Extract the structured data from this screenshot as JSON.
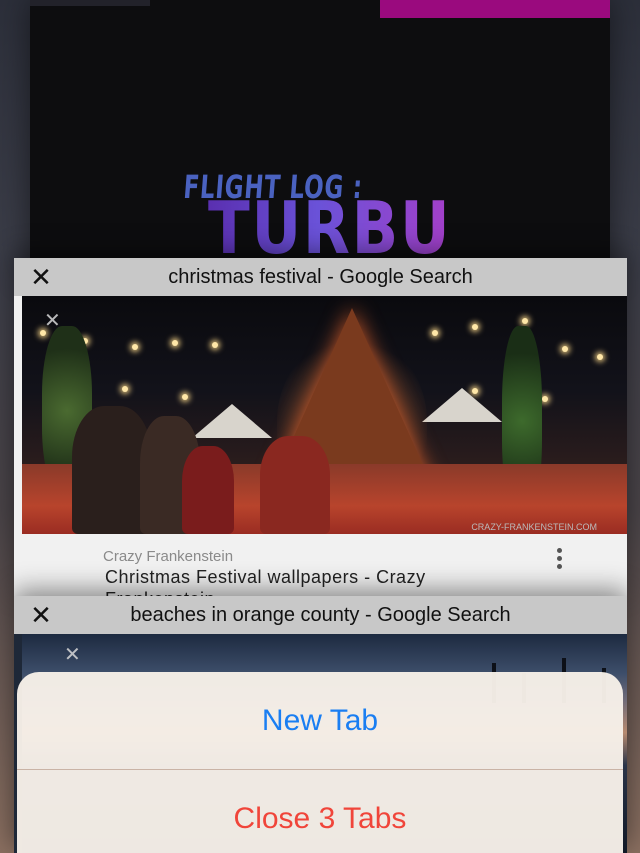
{
  "tabs": [
    {
      "title": "",
      "content": {
        "heading_small": "FLIGHT LOG :",
        "heading_big": "TURBU"
      }
    },
    {
      "title": "christmas festival - Google Search",
      "close_glyph": "✕",
      "card": {
        "source": "Crazy Frankenstein",
        "caption_line1": "Christmas Festival wallpapers - Crazy",
        "caption_line2": "Frankenstein",
        "watermark": "CRAZY-FRANKENSTEIN.COM"
      }
    },
    {
      "title": "beaches in orange county - Google Search",
      "close_glyph": "✕"
    }
  ],
  "action_sheet": {
    "new_tab_label": "New Tab",
    "close_tabs_label": "Close 3 Tabs"
  },
  "colors": {
    "accent_blue": "#1a7ef2",
    "destructive_red": "#f0453a",
    "tab_header_gray": "#c8c8c8"
  }
}
